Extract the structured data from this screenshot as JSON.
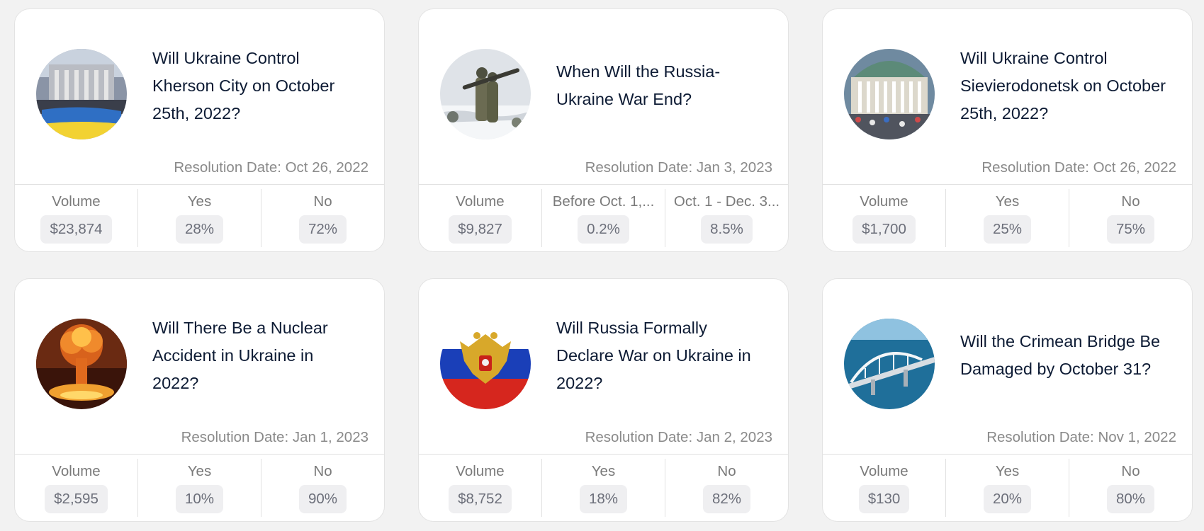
{
  "cards": [
    {
      "title": "Will Ukraine Control Kherson City on October 25th, 2022?",
      "resolution": "Resolution Date: Oct 26, 2022",
      "stats": [
        {
          "label": "Volume",
          "value": "$23,874"
        },
        {
          "label": "Yes",
          "value": "28%"
        },
        {
          "label": "No",
          "value": "72%"
        }
      ]
    },
    {
      "title": "When Will the Russia-Ukraine War End?",
      "resolution": "Resolution Date: Jan 3, 2023",
      "stats": [
        {
          "label": "Volume",
          "value": "$9,827"
        },
        {
          "label": "Before Oct. 1,...",
          "value": "0.2%"
        },
        {
          "label": "Oct. 1 - Dec. 3...",
          "value": "8.5%"
        }
      ]
    },
    {
      "title": "Will Ukraine Control Sievierodonetsk on October 25th, 2022?",
      "resolution": "Resolution Date: Oct 26, 2022",
      "stats": [
        {
          "label": "Volume",
          "value": "$1,700"
        },
        {
          "label": "Yes",
          "value": "25%"
        },
        {
          "label": "No",
          "value": "75%"
        }
      ]
    },
    {
      "title": "Will There Be a Nuclear Accident in Ukraine in 2022?",
      "resolution": "Resolution Date: Jan 1, 2023",
      "stats": [
        {
          "label": "Volume",
          "value": "$2,595"
        },
        {
          "label": "Yes",
          "value": "10%"
        },
        {
          "label": "No",
          "value": "90%"
        }
      ]
    },
    {
      "title": "Will Russia Formally Declare War on Ukraine in 2022?",
      "resolution": "Resolution Date: Jan 2, 2023",
      "stats": [
        {
          "label": "Volume",
          "value": "$8,752"
        },
        {
          "label": "Yes",
          "value": "18%"
        },
        {
          "label": "No",
          "value": "82%"
        }
      ]
    },
    {
      "title": "Will the Crimean Bridge Be Damaged by October 31?",
      "resolution": "Resolution Date: Nov 1, 2022",
      "stats": [
        {
          "label": "Volume",
          "value": "$130"
        },
        {
          "label": "Yes",
          "value": "20%"
        },
        {
          "label": "No",
          "value": "80%"
        }
      ]
    }
  ]
}
